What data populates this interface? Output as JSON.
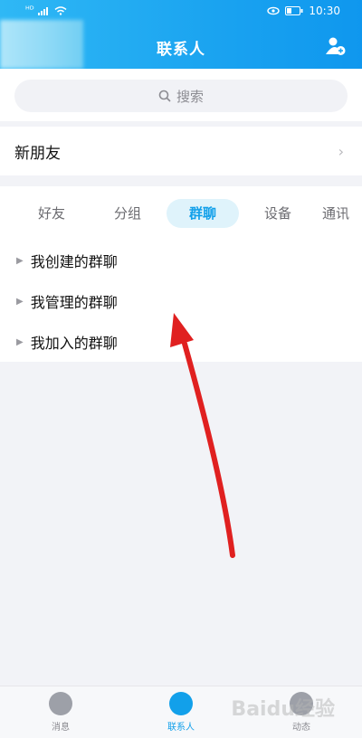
{
  "status": {
    "time": "10:30",
    "carrier": "ᴴᴰ"
  },
  "header": {
    "title": "联系人"
  },
  "search": {
    "placeholder": "搜索"
  },
  "new_friends": {
    "label": "新朋友"
  },
  "tabs": [
    {
      "label": "好友"
    },
    {
      "label": "分组"
    },
    {
      "label": "群聊"
    },
    {
      "label": "设备"
    },
    {
      "label": "通讯"
    }
  ],
  "groups": [
    {
      "label": "我创建的群聊"
    },
    {
      "label": "我管理的群聊"
    },
    {
      "label": "我加入的群聊"
    }
  ],
  "nav": [
    {
      "label": "消息"
    },
    {
      "label": "联系人"
    },
    {
      "label": "动态"
    }
  ],
  "watermark": "Baidu经验",
  "colors": {
    "accent": "#12a0ea",
    "arrow": "#e02020"
  }
}
